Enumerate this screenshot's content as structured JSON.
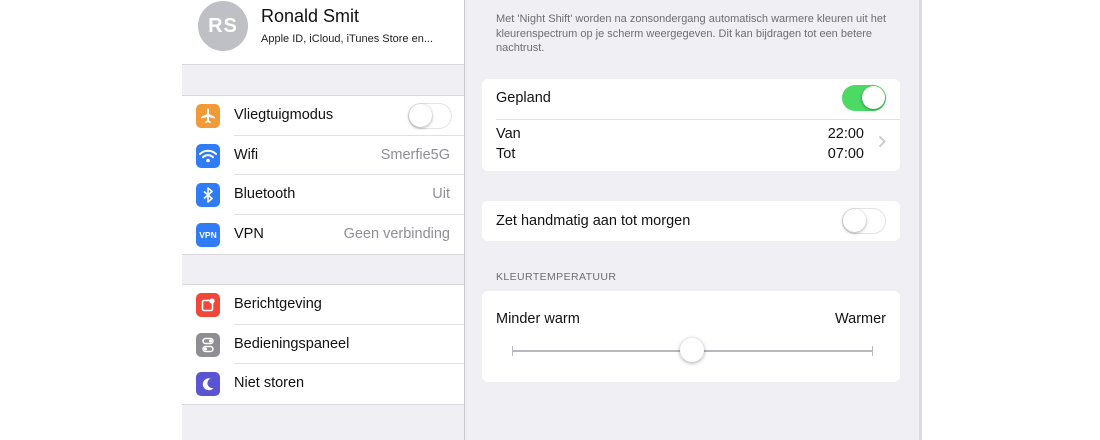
{
  "profile": {
    "initials": "RS",
    "name": "Ronald Smit",
    "subtitle": "Apple ID, iCloud, iTunes Store en..."
  },
  "connectivity": [
    {
      "label": "Vliegtuigmodus",
      "value": "",
      "icon": "airplane-icon",
      "color": "#f19a38",
      "toggle": "off"
    },
    {
      "label": "Wifi",
      "value": "Smerfie5G",
      "icon": "wifi-icon",
      "color": "#2f7cf6"
    },
    {
      "label": "Bluetooth",
      "value": "Uit",
      "icon": "bluetooth-icon",
      "color": "#2f7cf6"
    },
    {
      "label": "VPN",
      "value": "Geen verbinding",
      "icon": "vpn-icon",
      "icon_text": "VPN",
      "color": "#2f7cf6"
    }
  ],
  "system": [
    {
      "label": "Berichtgeving",
      "icon": "notifications-icon",
      "color": "#f0473b"
    },
    {
      "label": "Bedieningspaneel",
      "icon": "control-center-icon",
      "color": "#8e8e93"
    },
    {
      "label": "Niet storen",
      "icon": "moon-icon",
      "color": "#5b55d3"
    }
  ],
  "night_shift": {
    "description": "Met 'Night Shift' worden na zonsondergang automatisch warmere kleuren uit het kleurenspectrum op je scherm weergegeven. Dit kan bijdragen tot een betere nachtrust.",
    "scheduled_label": "Gepland",
    "scheduled_on": true,
    "from_label": "Van",
    "from_value": "22:00",
    "to_label": "Tot",
    "to_value": "07:00",
    "manual_label": "Zet handmatig aan tot morgen",
    "manual_on": false,
    "color_temp_header": "KLEURTEMPERATUUR",
    "less_warm_label": "Minder warm",
    "warmer_label": "Warmer",
    "slider_level": 0.5
  },
  "colors": {
    "toggle_on": "#4cd964",
    "accent_blue": "#2f7cf6",
    "group_background": "#efeff4"
  }
}
